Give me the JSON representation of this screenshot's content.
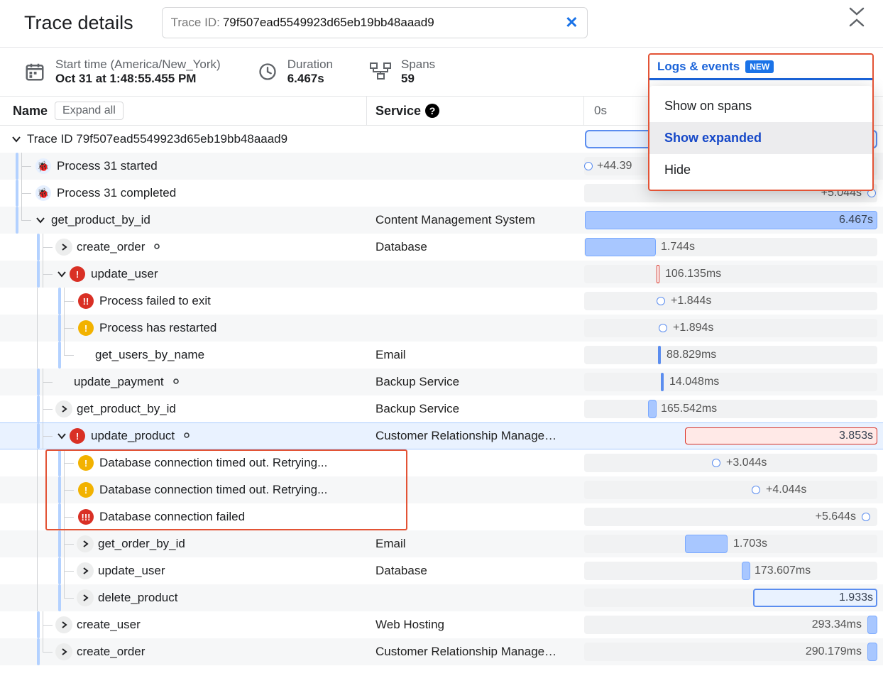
{
  "header": {
    "title": "Trace details",
    "trace_prefix": "Trace ID:",
    "trace_id": "79f507ead5549923d65eb19bb48aaad9"
  },
  "meta": {
    "start_label": "Start time (America/New_York)",
    "start_value": "Oct 31 at 1:48:55.455 PM",
    "duration_label": "Duration",
    "duration_value": "6.467s",
    "spans_label": "Spans",
    "spans_value": "59"
  },
  "columns": {
    "name": "Name",
    "expand_all": "Expand all",
    "service": "Service",
    "time_origin": "0s"
  },
  "popup": {
    "tab_label": "Logs & events",
    "badge": "NEW",
    "items": [
      "Show on spans",
      "Show expanded",
      "Hide"
    ],
    "selected_index": 1
  },
  "rows": [
    {
      "id": "r0",
      "name": "Trace ID 79f507ead5549923d65eb19bb48aaad9"
    },
    {
      "id": "r1",
      "name": "Process 31 started",
      "time": "+44.39"
    },
    {
      "id": "r2",
      "name": "Process 31 completed",
      "time": "+5.044s"
    },
    {
      "id": "r3",
      "name": "get_product_by_id",
      "service": "Content Management System",
      "time": "6.467s"
    },
    {
      "id": "r4",
      "name": "create_order",
      "service": "Database",
      "time": "1.744s"
    },
    {
      "id": "r5",
      "name": "update_user",
      "time": "106.135ms"
    },
    {
      "id": "r6",
      "name": "Process failed to exit",
      "time": "+1.844s"
    },
    {
      "id": "r7",
      "name": "Process has restarted",
      "time": "+1.894s"
    },
    {
      "id": "r8",
      "name": "get_users_by_name",
      "service": "Email",
      "time": "88.829ms"
    },
    {
      "id": "r9",
      "name": "update_payment",
      "service": "Backup Service",
      "time": "14.048ms"
    },
    {
      "id": "r10",
      "name": "get_product_by_id",
      "service": "Backup Service",
      "time": "165.542ms"
    },
    {
      "id": "r11",
      "name": "update_product",
      "service": "Customer Relationship Manage…",
      "time": "3.853s"
    },
    {
      "id": "r12",
      "name": "Database connection timed out. Retrying...",
      "time": "+3.044s"
    },
    {
      "id": "r13",
      "name": "Database connection timed out. Retrying...",
      "time": "+4.044s"
    },
    {
      "id": "r14",
      "name": "Database connection failed",
      "time": "+5.644s"
    },
    {
      "id": "r15",
      "name": "get_order_by_id",
      "service": "Email",
      "time": "1.703s"
    },
    {
      "id": "r16",
      "name": "update_user",
      "service": "Database",
      "time": "173.607ms"
    },
    {
      "id": "r17",
      "name": "delete_product",
      "time": "1.933s"
    },
    {
      "id": "r18",
      "name": "create_user",
      "service": "Web Hosting",
      "time": "293.34ms"
    },
    {
      "id": "r19",
      "name": "create_order",
      "service": "Customer Relationship Manage…",
      "time": "290.179ms"
    }
  ]
}
